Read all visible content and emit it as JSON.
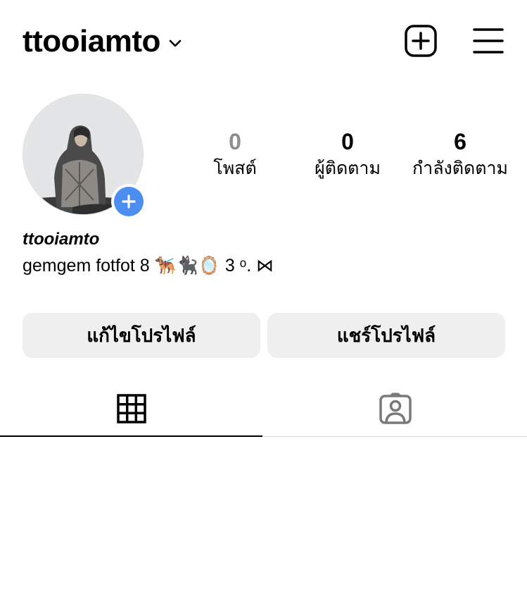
{
  "header": {
    "username": "ttooiamto",
    "username_chevron_icon": "chevron-down-icon",
    "new_post_icon": "plus-square-icon",
    "menu_icon": "hamburger-menu-icon"
  },
  "profile": {
    "avatar_icon": "profile-photo",
    "add_story_icon": "plus-icon",
    "accent_color": "#4b8ef0"
  },
  "stats": {
    "posts": {
      "count": "0",
      "label": "โพสต์"
    },
    "followers": {
      "count": "0",
      "label": "ผู้ติดตาม"
    },
    "following": {
      "count": "6",
      "label": "กำลังติดตาม"
    }
  },
  "bio": {
    "name": "ttooiamto",
    "text": "gemgem fotfot 8 🐕‍🦺🐈‍⬛🪞 3 ᵒ. ⋈"
  },
  "buttons": {
    "edit_profile": "แก้ไขโปรไฟล์",
    "share_profile": "แชร์โปรไฟล์"
  },
  "tabs": {
    "grid_icon": "grid-icon",
    "tagged_icon": "tagged-person-icon",
    "active": "grid"
  }
}
